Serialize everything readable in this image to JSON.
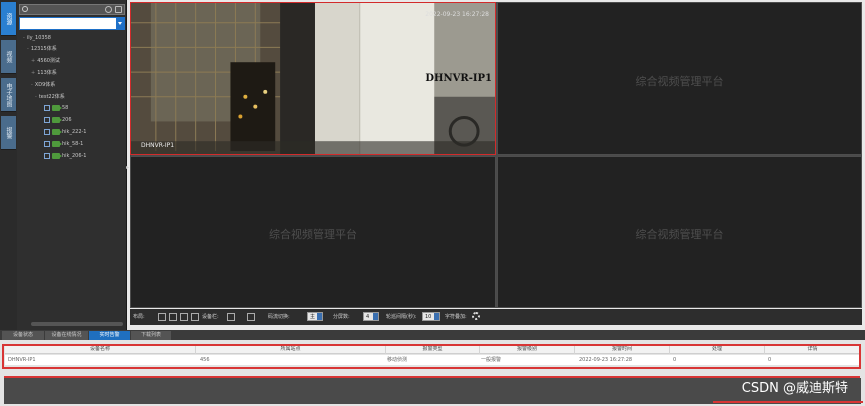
{
  "rail": {
    "tabs": [
      "资源",
      "视频",
      "电子地图",
      "报警"
    ]
  },
  "tree": {
    "nodes": [
      {
        "label": "ily_10358"
      },
      {
        "label": "12315体系"
      },
      {
        "label": "4560测试"
      },
      {
        "label": "113体系"
      },
      {
        "label": "XD9体系"
      },
      {
        "label": "test22体系"
      },
      {
        "label": "58"
      },
      {
        "label": "206"
      },
      {
        "label": "hik_222-1"
      },
      {
        "label": "hik_58-1"
      },
      {
        "label": "hik_206-1"
      }
    ]
  },
  "video": {
    "placeholder": "综合视频管理平台",
    "active_timestamp": "2022-09-23 16:27:28",
    "active_channel": "DHNVR-IP1",
    "active_name": "DHNVR-IP1"
  },
  "toolbar": {
    "layout_label": "布局:",
    "device_label": "设备栏:",
    "flow_label": "码流切换:",
    "flow_value": "主",
    "split_label": "分屏数:",
    "split_value": "4",
    "interval_label": "轮巡间隔(秒):",
    "interval_value": "10",
    "stream_label": "字符叠加:"
  },
  "bottom": {
    "tabs": [
      "设备状态",
      "设备在线情况",
      "实时告警",
      "下载列表"
    ],
    "active_tab": 2,
    "columns": [
      "设备名称",
      "所属站点",
      "报警类型",
      "报警级别",
      "报警时间",
      "处理",
      "详情"
    ],
    "rows": [
      [
        "DHNVR-IP1",
        "456",
        "移动侦测",
        "一般报警",
        "2022-09-23 16:27:28",
        "0",
        "0"
      ]
    ]
  },
  "watermark": "CSDN @威迪斯特",
  "colors": {
    "accent": "#1f6fbf",
    "highlight": "#d83535"
  }
}
